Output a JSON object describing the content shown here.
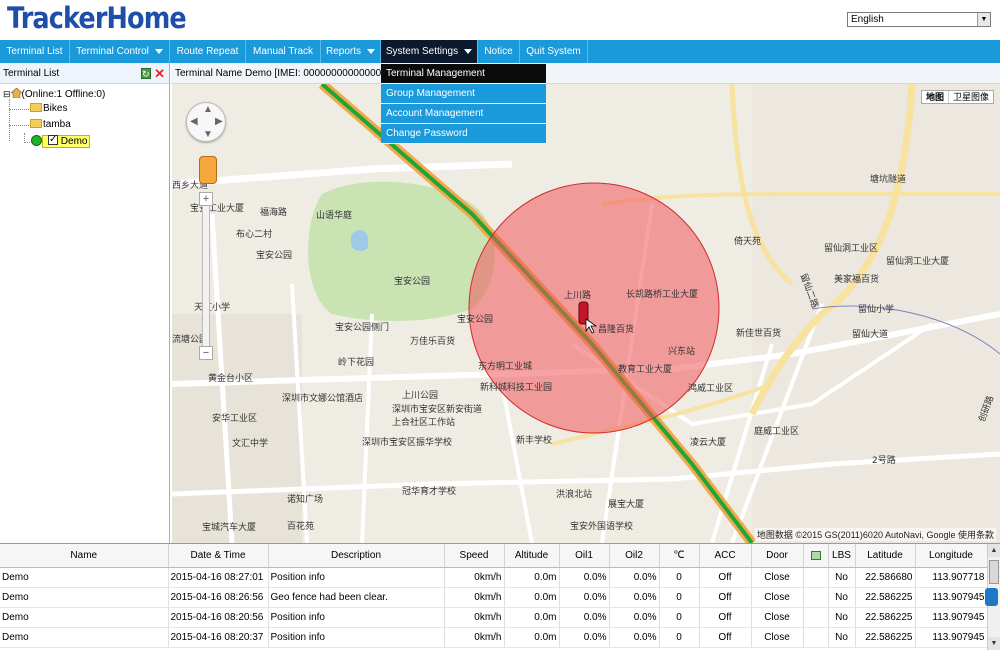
{
  "app": {
    "logo": "TrackerHome"
  },
  "language": {
    "selected": "English"
  },
  "nav": {
    "items": [
      {
        "label": "Terminal List",
        "caret": false
      },
      {
        "label": "Terminal Control",
        "caret": true
      },
      {
        "label": "Route Repeat",
        "caret": false
      },
      {
        "label": "Manual Track",
        "caret": false
      },
      {
        "label": "Reports",
        "caret": true
      },
      {
        "label": "System Settings",
        "caret": true,
        "active": true
      },
      {
        "label": "Notice",
        "caret": false
      },
      {
        "label": "Quit System",
        "caret": false
      }
    ],
    "dropdown": [
      "Terminal Management",
      "Group Management",
      "Account Management",
      "Change Password"
    ]
  },
  "left_panel": {
    "title": "Terminal List",
    "root": "(Online:1   Offline:0)",
    "groups": [
      "Bikes",
      "tamba"
    ],
    "device": "Demo"
  },
  "info_bar": {
    "text": "Terminal Name Demo [IMEI: 000000000000000",
    "tail": "2-31"
  },
  "map": {
    "type_map": "地图",
    "type_satellite": "卫星图像",
    "copyright": "地图数据 ©2015 GS(2011)6020 AutoNavi, Google    使用条款",
    "labels": [
      {
        "t": "西乡大道"
      },
      {
        "t": "福海路"
      },
      {
        "t": "宝安工业大厦"
      },
      {
        "t": "布心二村"
      },
      {
        "t": "宝安公园"
      },
      {
        "t": "山语华庭"
      },
      {
        "t": "天虹小学"
      },
      {
        "t": "流塘公园"
      },
      {
        "t": "宝安公园侧门"
      },
      {
        "t": "岭下花园"
      },
      {
        "t": "黄金台小区"
      },
      {
        "t": "万佳乐百货"
      },
      {
        "t": "上川公园"
      },
      {
        "t": "深圳市文娜公馆酒店"
      },
      {
        "t": "安华工业区"
      },
      {
        "t": "深圳市宝安区新安街道上合社区工作站"
      },
      {
        "t": "文汇中学"
      },
      {
        "t": "深圳市宝安区振华学校"
      },
      {
        "t": "诺知广场"
      },
      {
        "t": "冠华育才学校"
      },
      {
        "t": "百花苑"
      },
      {
        "t": "宝城汽车大厦"
      },
      {
        "t": "东方明工业城"
      },
      {
        "t": "新科城科技工业园"
      },
      {
        "t": "新丰学校"
      },
      {
        "t": "上川路"
      },
      {
        "t": "长凯路桥工业大厦"
      },
      {
        "t": "昌隆百货"
      },
      {
        "t": "教育工业大厦"
      },
      {
        "t": "兴东站"
      },
      {
        "t": "新佳世百货"
      },
      {
        "t": "鸿威工业区"
      },
      {
        "t": "庭威工业区"
      },
      {
        "t": "凌云大厦"
      },
      {
        "t": "洪浪北站"
      },
      {
        "t": "展宝大厦"
      },
      {
        "t": "宝安外国语学校"
      },
      {
        "t": "倚天苑"
      },
      {
        "t": "留仙洞工业区"
      },
      {
        "t": "塘坑隧道"
      },
      {
        "t": "美家福百货"
      },
      {
        "t": "留仙小学"
      },
      {
        "t": "留仙大道"
      },
      {
        "t": "2号路"
      },
      {
        "t": "创研路"
      },
      {
        "t": "留仙洞工业大厦"
      },
      {
        "t": "宝安公园"
      },
      {
        "t": "留仙二路"
      }
    ]
  },
  "grid": {
    "columns": [
      "Name",
      "Date & Time",
      "Description",
      "Speed",
      "Altitude",
      "Oil1",
      "Oil2",
      "℃",
      "ACC",
      "Door",
      "",
      "LBS",
      "Latitude",
      "Longitude"
    ],
    "rows": [
      [
        "Demo",
        "2015-04-16 08:27:01",
        "Position info",
        "0km/h",
        "0.0m",
        "0.0%",
        "0.0%",
        "0",
        "Off",
        "Close",
        "",
        "No",
        "22.586680",
        "113.907718"
      ],
      [
        "Demo",
        "2015-04-16 08:26:56",
        "Geo fence had been clear.",
        "0km/h",
        "0.0m",
        "0.0%",
        "0.0%",
        "0",
        "Off",
        "Close",
        "",
        "No",
        "22.586225",
        "113.907945"
      ],
      [
        "Demo",
        "2015-04-16 08:20:56",
        "Position info",
        "0km/h",
        "0.0m",
        "0.0%",
        "0.0%",
        "0",
        "Off",
        "Close",
        "",
        "No",
        "22.586225",
        "113.907945"
      ],
      [
        "Demo",
        "2015-04-16 08:20:37",
        "Position info",
        "0km/h",
        "0.0m",
        "0.0%",
        "0.0%",
        "0",
        "Off",
        "Close",
        "",
        "No",
        "22.586225",
        "113.907945"
      ]
    ]
  },
  "colors": {
    "nav_bg": "#1a9adb",
    "active_nav": "#0b1a2c",
    "geofence": "#f0585c",
    "logo": "#1d4ea8"
  }
}
